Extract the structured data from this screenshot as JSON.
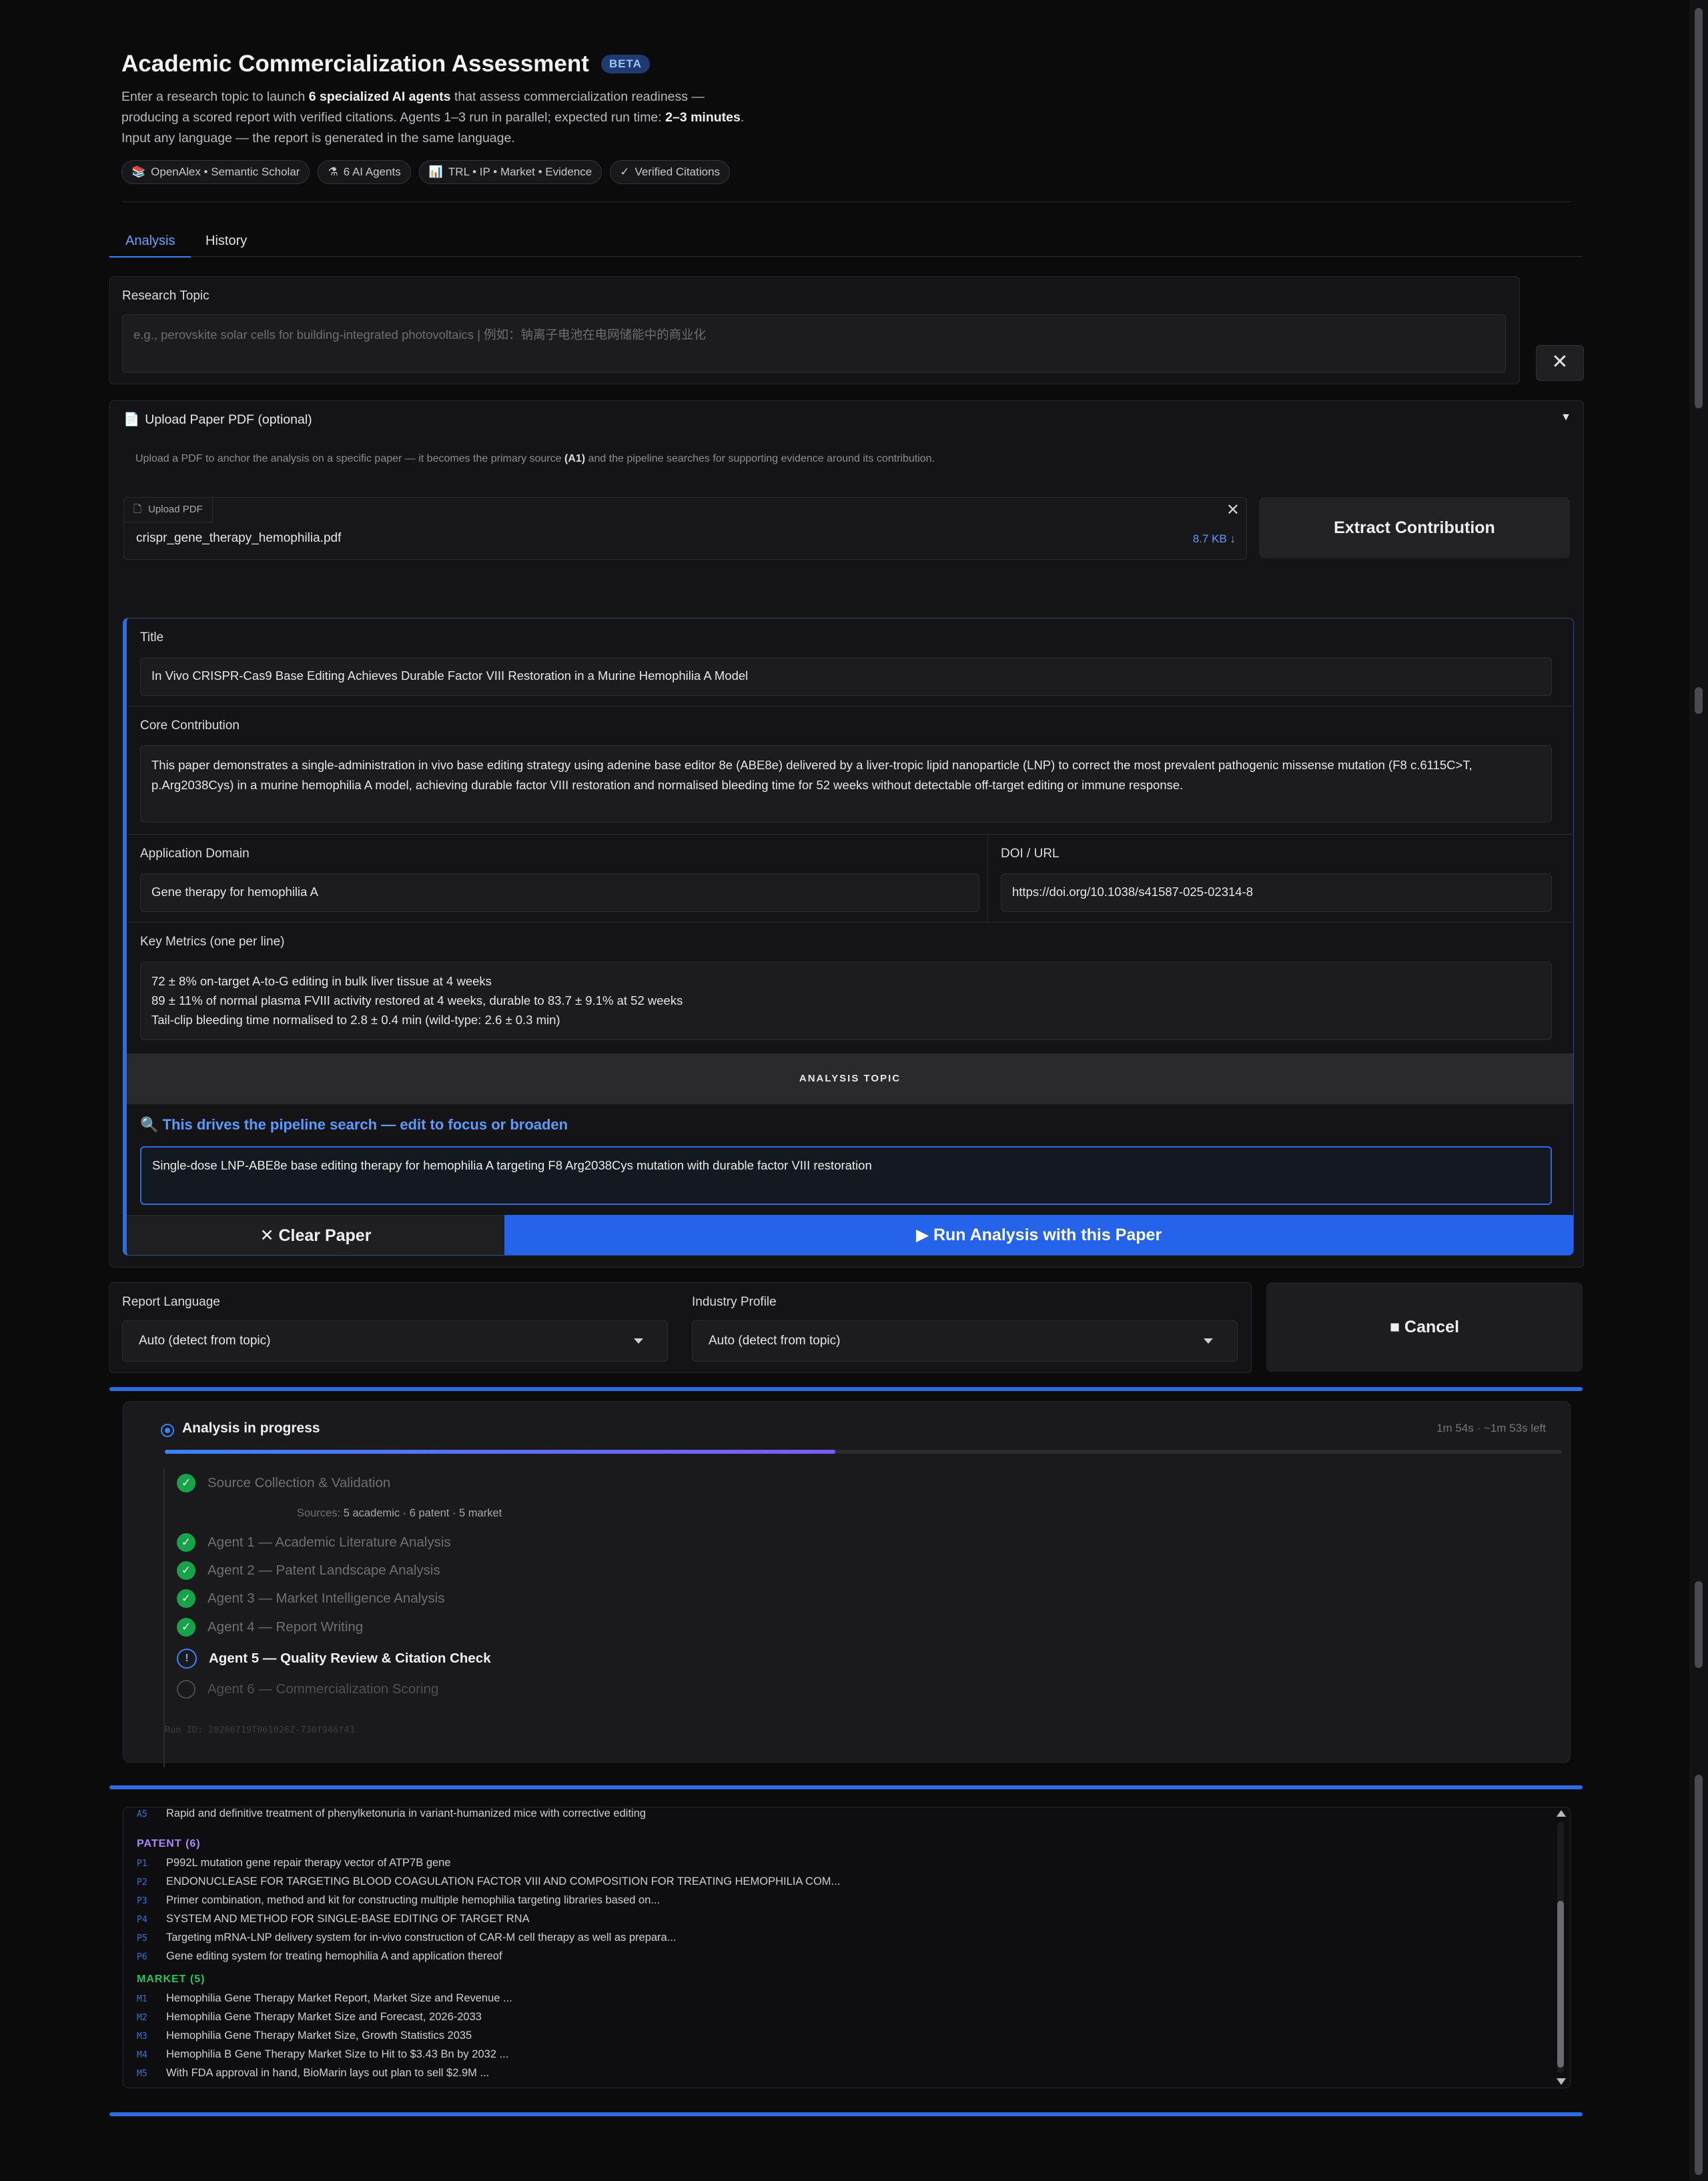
{
  "header": {
    "title": "Academic Commercialization Assessment",
    "badge": "BETA",
    "intro_1": "Enter a research topic to launch ",
    "intro_bold_1": "6 specialized AI agents",
    "intro_2": " that assess commercialization readiness — producing a scored report with verified citations. Agents 1–3 run in parallel; expected run time: ",
    "intro_bold_2": "2–3 minutes",
    "intro_3": ". Input any language — the report is generated in the same language.",
    "chips": [
      {
        "icon": "📚",
        "label": "OpenAlex • Semantic Scholar"
      },
      {
        "icon": "⚗",
        "label": "6 AI Agents"
      },
      {
        "icon": "📊",
        "label": "TRL • IP • Market • Evidence"
      },
      {
        "icon": "✓",
        "label": "Verified Citations"
      }
    ]
  },
  "tabs": [
    "Analysis",
    "History"
  ],
  "research_topic": {
    "label": "Research Topic",
    "placeholder": "e.g., perovskite solar cells for building-integrated photovoltaics | 例如：钠离子电池在电网储能中的商业化"
  },
  "upload": {
    "heading": "Upload Paper PDF (optional)",
    "toggle": "▼",
    "desc_1": "Upload a PDF to anchor the analysis on a specific paper — it becomes the primary source ",
    "desc_bold": "(A1)",
    "desc_2": " and the pipeline searches for supporting evidence around its contribution.",
    "upload_label": "Upload PDF",
    "file_name": "crispr_gene_therapy_hemophilia.pdf",
    "file_size": "8.7 KB ↓",
    "extract_button": "Extract Contribution"
  },
  "paper": {
    "title_label": "Title",
    "title_value": "In Vivo CRISPR-Cas9 Base Editing Achieves Durable Factor VIII Restoration in a Murine Hemophilia A Model",
    "core_label": "Core Contribution",
    "core_value": "This paper demonstrates a single-administration in vivo base editing strategy using adenine base editor 8e (ABE8e) delivered by a liver-tropic lipid nanoparticle (LNP) to correct the most prevalent pathogenic missense mutation (F8 c.6115C>T, p.Arg2038Cys) in a murine hemophilia A model, achieving durable factor VIII restoration and normalised bleeding time for 52 weeks without detectable off-target editing or immune response.",
    "domain_label": "Application Domain",
    "domain_value": "Gene therapy for hemophilia A",
    "doi_label": "DOI / URL",
    "doi_value": "https://doi.org/10.1038/s41587-025-02314-8",
    "metrics_label": "Key Metrics (one per line)",
    "metrics": [
      "72 ± 8% on-target A-to-G editing in bulk liver tissue at 4 weeks",
      "89 ± 11% of normal plasma FVIII activity restored at 4 weeks, durable to 83.7 ± 9.1% at 52 weeks",
      "Tail-clip bleeding time normalised to 2.8 ± 0.4 min (wild-type: 2.6 ± 0.3 min)"
    ],
    "analysis_topic_heading": "ANALYSIS TOPIC",
    "drives_icon": "🔍",
    "drives_text": "This drives the pipeline search — edit to focus or broaden",
    "topic_value": "Single-dose LNP-ABE8e base editing therapy for hemophilia A targeting F8 Arg2038Cys mutation with durable factor VIII restoration",
    "clear_button": "✕ Clear Paper",
    "run_button": "▶ Run Analysis with this Paper"
  },
  "options": {
    "language_label": "Report Language",
    "language_value": "Auto (detect from topic)",
    "industry_label": "Industry Profile",
    "industry_value": "Auto (detect from topic)",
    "cancel_button": "■ Cancel"
  },
  "progress": {
    "title": "Analysis in progress",
    "elapsed": "1m 54s · ~1m 53s left",
    "fraction": 0.48,
    "steps": [
      {
        "label": "Source Collection & Validation",
        "status": "done"
      },
      {
        "label": "Agent 1 — Academic Literature Analysis",
        "status": "done"
      },
      {
        "label": "Agent 2 — Patent Landscape Analysis",
        "status": "done"
      },
      {
        "label": "Agent 3 — Market Intelligence Analysis",
        "status": "done"
      },
      {
        "label": "Agent 4 — Report Writing",
        "status": "done"
      },
      {
        "label": "Agent 5 — Quality Review & Citation Check",
        "status": "running"
      },
      {
        "label": "Agent 6 — Commercialization Scoring",
        "status": "pending"
      }
    ],
    "sources_prefix": "Sources: ",
    "sources_value": "5 academic · 6 patent · 5 market",
    "run_id": "Run ID: 20260719T061026Z-730f946f43"
  },
  "sources": {
    "academic_tail": {
      "code": "A5",
      "text": "Rapid and definitive treatment of phenylketonuria in variant-humanized mice with corrective editing"
    },
    "patent_heading": "PATENT (6)",
    "patents": [
      {
        "code": "P1",
        "text": "P992L mutation gene repair therapy vector of ATP7B gene"
      },
      {
        "code": "P2",
        "text": "ENDONUCLEASE FOR TARGETING BLOOD COAGULATION FACTOR VIII AND COMPOSITION FOR TREATING HEMOPHILIA COM..."
      },
      {
        "code": "P3",
        "text": "Primer combination, method and kit for constructing multiple hemophilia targeting libraries based on..."
      },
      {
        "code": "P4",
        "text": "SYSTEM AND METHOD FOR SINGLE-BASE EDITING OF TARGET RNA"
      },
      {
        "code": "P5",
        "text": "Targeting mRNA-LNP delivery system for in-vivo construction of CAR-M cell therapy as well as prepara..."
      },
      {
        "code": "P6",
        "text": "Gene editing system for treating hemophilia A and application thereof"
      }
    ],
    "market_heading": "MARKET (5)",
    "markets": [
      {
        "code": "M1",
        "text": "Hemophilia Gene Therapy Market Report, Market Size and Revenue ..."
      },
      {
        "code": "M2",
        "text": "Hemophilia Gene Therapy Market Size and Forecast, 2026-2033"
      },
      {
        "code": "M3",
        "text": "Hemophilia Gene Therapy Market Size, Growth Statistics 2035"
      },
      {
        "code": "M4",
        "text": "Hemophilia B Gene Therapy Market Size to Hit to $3.43 Bn by 2032 ..."
      },
      {
        "code": "M5",
        "text": "With FDA approval in hand, BioMarin lays out plan to sell $2.9M ..."
      }
    ]
  },
  "colors": {
    "accent": "#3b82f6",
    "patent_heading": "#a78bfa",
    "market_heading": "#22c55e",
    "success": "#16a34a"
  }
}
